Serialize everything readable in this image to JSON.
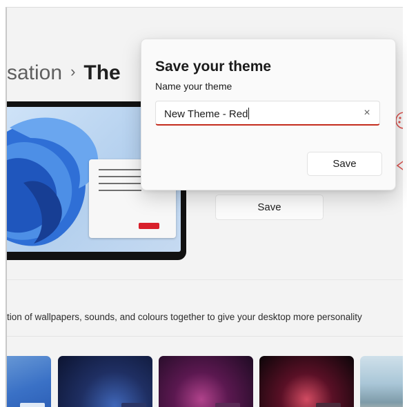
{
  "breadcrumb": {
    "parent": "sation",
    "separator": "›",
    "current": "The"
  },
  "main": {
    "save_label": "Save",
    "description": "tion of wallpapers, sounds, and colours together to give your desktop more personality"
  },
  "dialog": {
    "title": "Save your theme",
    "field_label": "Name your theme",
    "input_value": "New Theme - Red",
    "clear_icon": "×",
    "save_label": "Save"
  },
  "colors": {
    "accent": "#c42b1c",
    "mini_button": "#d81f2a",
    "background": "#f3f3f3"
  },
  "icons": [
    "palette-icon",
    "speaker-icon",
    "close-icon"
  ]
}
